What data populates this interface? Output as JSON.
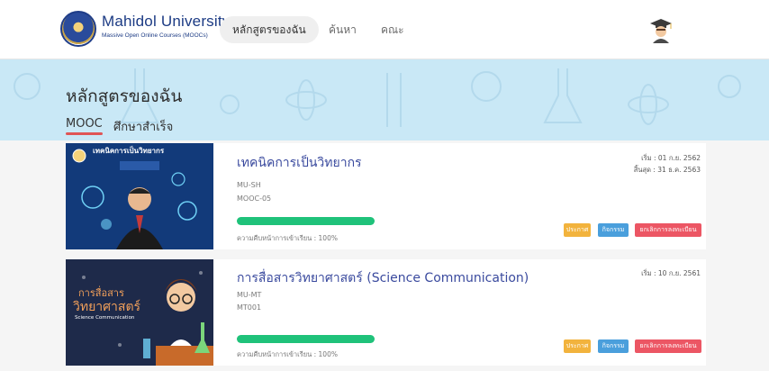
{
  "brand": {
    "name": "Mahidol University",
    "tagline": "Massive Open Online Courses (MOOCs)"
  },
  "nav": {
    "tabs": [
      {
        "label": "หลักสูตรของฉัน",
        "active": true
      },
      {
        "label": "ค้นหา",
        "active": false
      },
      {
        "label": "คณะ",
        "active": false
      }
    ]
  },
  "page": {
    "title": "หลักสูตรของฉัน",
    "subtabs": [
      {
        "label": "MOOC",
        "active": true
      },
      {
        "label": "ศึกษาสำเร็จ",
        "active": false
      }
    ]
  },
  "courses": [
    {
      "title": "เทคนิคการเป็นวิทยากร",
      "faculty": "MU-SH",
      "code": "MOOC-05",
      "progress": 100,
      "progress_label": "ความคืบหน้าการเข้าเรียน : 100%",
      "start": "เริ่ม : 01 ก.ย. 2562",
      "end": "สิ้นสุด : 31 ธ.ค. 2563",
      "thumb_text": "เทคนิคการเป็นวิทยากร",
      "buttons": {
        "announce": "ประกาศ",
        "activity": "กิจกรรม",
        "cert": "ยกเลิกการลงทะเบียน"
      }
    },
    {
      "title": "การสื่อสารวิทยาศาสตร์ (Science Communication)",
      "faculty": "MU-MT",
      "code": "MT001",
      "progress": 100,
      "progress_label": "ความคืบหน้าการเข้าเรียน : 100%",
      "start": "เริ่ม : 10 ก.ย. 2561",
      "thumb_line1": "การสื่อสาร",
      "thumb_line2": "วิทยาศาสตร์",
      "thumb_line3": "Science Communication",
      "buttons": {
        "announce": "ประกาศ",
        "activity": "กิจกรรม",
        "cert": "ยกเลิกการลงทะเบียน"
      }
    }
  ],
  "colors": {
    "banner": "#c9e8f6",
    "progress": "#1fc27a",
    "announce": "#f2b33d",
    "activity": "#4a9fdc",
    "cert": "#ec5664",
    "title": "#3a4a9e"
  }
}
